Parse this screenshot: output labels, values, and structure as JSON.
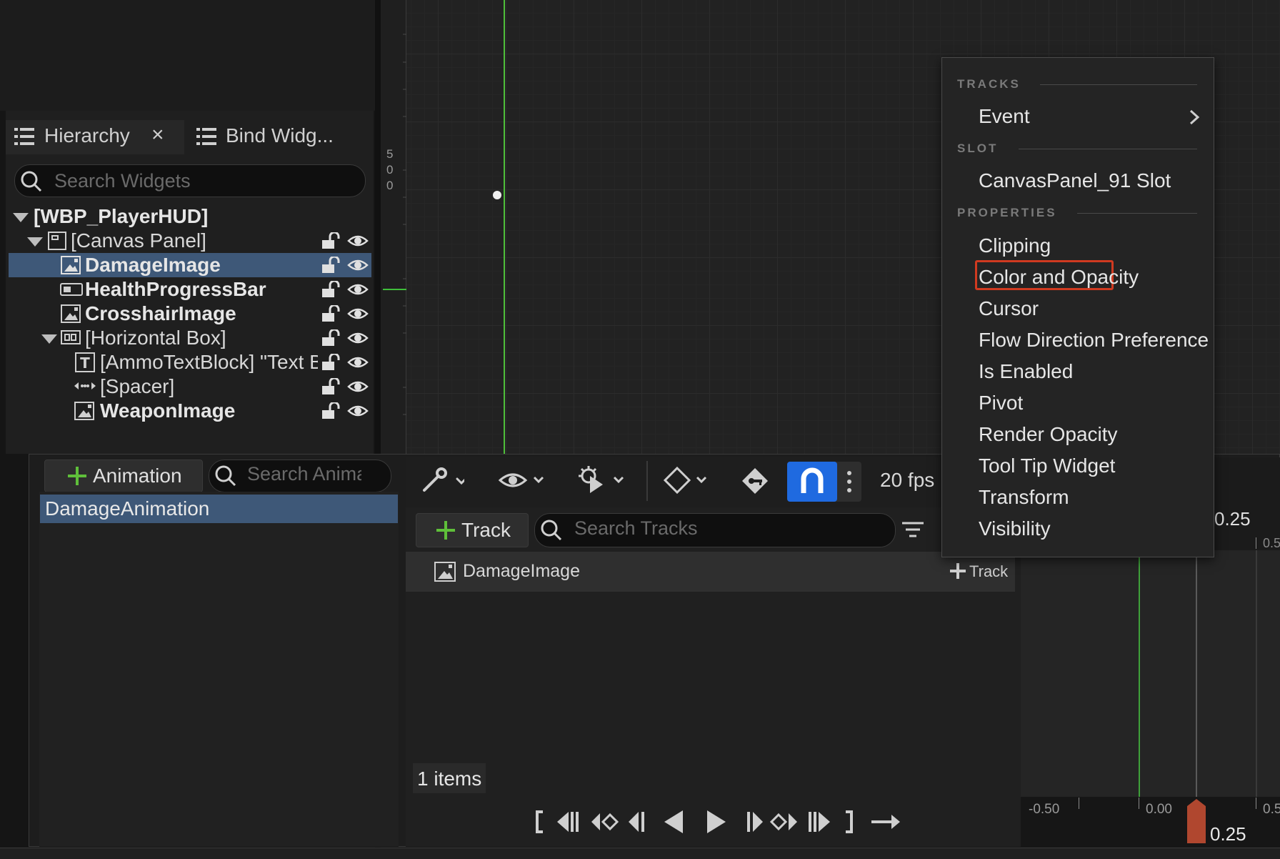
{
  "hierarchy": {
    "tab_title": "Hierarchy",
    "close_glyph": "×",
    "bind_tab_title": "Bind Widg...",
    "search_placeholder": "Search Widgets",
    "tree": [
      {
        "label": "[WBP_PlayerHUD]"
      },
      {
        "label": "[Canvas Panel]"
      },
      {
        "label": "DamageImage"
      },
      {
        "label": "HealthProgressBar"
      },
      {
        "label": "CrosshairImage"
      },
      {
        "label": "[Horizontal Box]"
      },
      {
        "label": "[AmmoTextBlock] \"Text B"
      },
      {
        "label": "[Spacer]"
      },
      {
        "label": "WeaponImage"
      }
    ]
  },
  "viewport": {
    "ruler_v_digits": [
      "5",
      "0",
      "0"
    ]
  },
  "animations": {
    "add_label": "Animation",
    "search_placeholder": "Search Anima",
    "items": [
      "DamageAnimation"
    ]
  },
  "sequencer": {
    "fps_label": "20 fps",
    "add_track_label": "Track",
    "search_placeholder": "Search Tracks",
    "track_name": "DamageImage",
    "track_add_label": "Track",
    "items_count": "1 items"
  },
  "timeline": {
    "time_top": "0.25",
    "tick_top_right": "0.5",
    "bottom_ticks": [
      "-0.50",
      "0.00",
      "0.5"
    ],
    "playhead_value": "0.25"
  },
  "context_menu": {
    "sections": [
      {
        "title": "TRACKS",
        "items": [
          "Event"
        ]
      },
      {
        "title": "SLOT",
        "items": [
          "CanvasPanel_91 Slot"
        ]
      },
      {
        "title": "PROPERTIES",
        "items": [
          "Clipping",
          "Color and Opacity",
          "Cursor",
          "Flow Direction Preference",
          "Is Enabled",
          "Pivot",
          "Render Opacity",
          "Tool Tip Widget",
          "Transform",
          "Visibility"
        ]
      }
    ],
    "highlighted_item": "Color and Opacity"
  },
  "colors": {
    "selection": "#3e5878",
    "accent_blue": "#1f6ae0",
    "highlight_border": "#d03a20",
    "green_plus": "#5fbf3a",
    "playhead": "#b0472f"
  }
}
